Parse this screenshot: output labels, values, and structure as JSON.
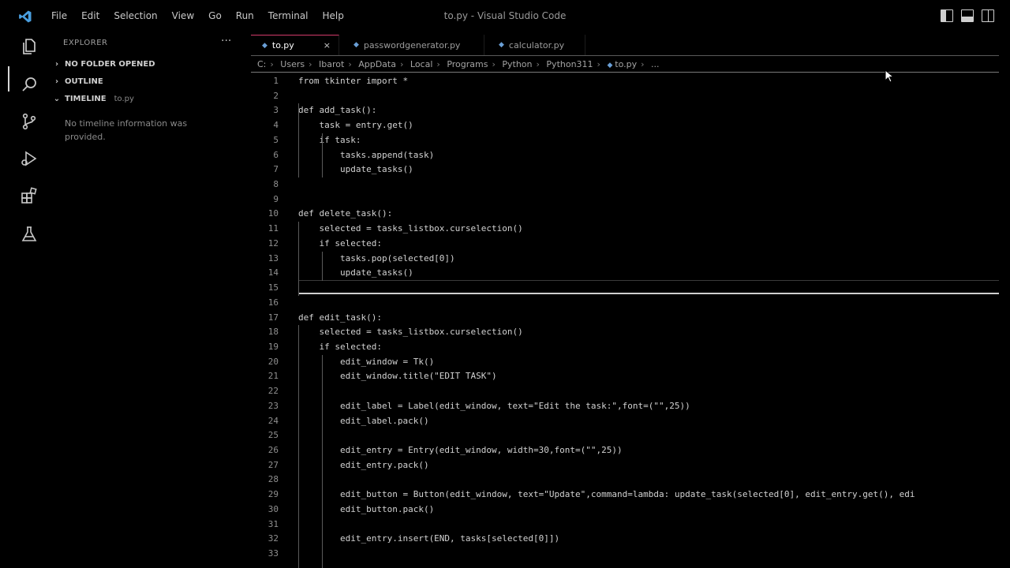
{
  "menu": [
    "File",
    "Edit",
    "Selection",
    "View",
    "Go",
    "Run",
    "Terminal",
    "Help"
  ],
  "window_title": "to.py - Visual Studio Code",
  "sidebar": {
    "title": "EXPLORER",
    "more": "···",
    "sections": [
      {
        "label": "NO FOLDER OPENED"
      },
      {
        "label": "OUTLINE"
      },
      {
        "label": "TIMELINE",
        "file": "to.py"
      }
    ],
    "timeline_message": "No timeline information was provided."
  },
  "tabs": [
    {
      "label": "to.py",
      "close": "×"
    },
    {
      "label": "passwordgenerator.py"
    },
    {
      "label": "calculator.py"
    }
  ],
  "breadcrumb": [
    "C:",
    "Users",
    "Ibarot",
    "AppData",
    "Local",
    "Programs",
    "Python",
    "Python311",
    "to.py",
    "..."
  ],
  "code_lines": [
    {
      "n": "1",
      "text": "from tkinter import *"
    },
    {
      "n": "2",
      "text": ""
    },
    {
      "n": "3",
      "text": "def add_task():"
    },
    {
      "n": "4",
      "text": "    task = entry.get()"
    },
    {
      "n": "5",
      "text": "    if task:"
    },
    {
      "n": "6",
      "text": "        tasks.append(task)"
    },
    {
      "n": "7",
      "text": "        update_tasks()"
    },
    {
      "n": "8",
      "text": ""
    },
    {
      "n": "9",
      "text": ""
    },
    {
      "n": "10",
      "text": "def delete_task():"
    },
    {
      "n": "11",
      "text": "    selected = tasks_listbox.curselection()"
    },
    {
      "n": "12",
      "text": "    if selected:"
    },
    {
      "n": "13",
      "text": "        tasks.pop(selected[0])"
    },
    {
      "n": "14",
      "text": "        update_tasks()"
    },
    {
      "n": "15",
      "text": ""
    },
    {
      "n": "16",
      "text": ""
    },
    {
      "n": "17",
      "text": "def edit_task():"
    },
    {
      "n": "18",
      "text": "    selected = tasks_listbox.curselection()"
    },
    {
      "n": "19",
      "text": "    if selected:"
    },
    {
      "n": "20",
      "text": "        edit_window = Tk()"
    },
    {
      "n": "21",
      "text": "        edit_window.title(\"EDIT TASK\")"
    },
    {
      "n": "22",
      "text": ""
    },
    {
      "n": "23",
      "text": "        edit_label = Label(edit_window, text=\"Edit the task:\",font=(\"\",25))"
    },
    {
      "n": "24",
      "text": "        edit_label.pack()"
    },
    {
      "n": "25",
      "text": ""
    },
    {
      "n": "26",
      "text": "        edit_entry = Entry(edit_window, width=30,font=(\"\",25))"
    },
    {
      "n": "27",
      "text": "        edit_entry.pack()"
    },
    {
      "n": "28",
      "text": ""
    },
    {
      "n": "29",
      "text": "        edit_button = Button(edit_window, text=\"Update\",command=lambda: update_task(selected[0], edit_entry.get(), edi"
    },
    {
      "n": "30",
      "text": "        edit_button.pack()"
    },
    {
      "n": "31",
      "text": ""
    },
    {
      "n": "32",
      "text": "        edit_entry.insert(END, tasks[selected[0]])"
    },
    {
      "n": "33",
      "text": ""
    }
  ],
  "colors": {
    "accent_tab": "#d23b6a",
    "py_icon": "#6a9fd6",
    "background": "#000000"
  }
}
